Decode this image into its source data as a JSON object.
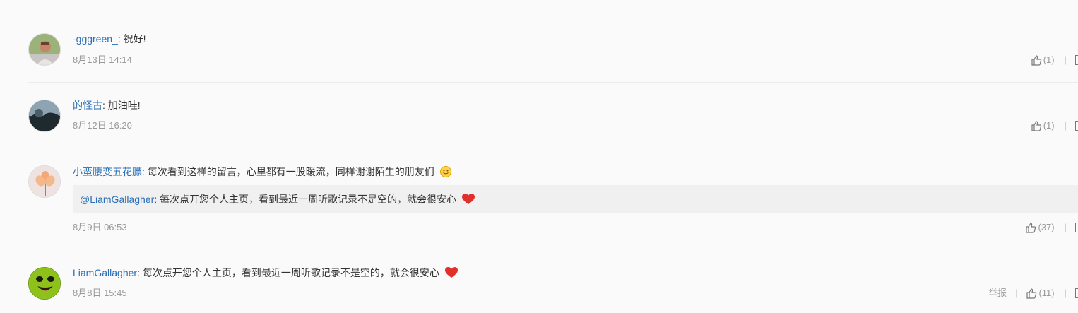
{
  "comments": [
    {
      "user": "-gggreen_",
      "text": "祝好!",
      "time": "8月13日 14:14",
      "likes": "(1)",
      "separator": "|"
    },
    {
      "user": "的怪古",
      "text": "加油哇!",
      "time": "8月12日 16:20",
      "likes": "(1)",
      "separator": "|"
    },
    {
      "user": "小蛮腰变五花膘",
      "text": "每次看到这样的留言，心里都有一股暖流，同样谢谢陌生的朋友们",
      "emoji": "smile-emoji",
      "quote": {
        "user": "@LiamGallagher",
        "text": "每次点开您个人主页，看到最近一周听歌记录不是空的，就会很安心",
        "emoji": "heart-emoji"
      },
      "time": "8月9日 06:53",
      "likes": "(37)",
      "separator": "|"
    },
    {
      "user": "LiamGallagher",
      "text": "每次点开您个人主页，看到最近一周听歌记录不是空的，就会很安心",
      "emoji": "heart-emoji",
      "time": "8月8日 15:45",
      "report": "举报",
      "likes": "(11)",
      "separator": "|"
    }
  ],
  "colon": ":",
  "colors": {
    "link": "#2a6fb8",
    "muted": "#999999",
    "heart": "#e0302c"
  }
}
